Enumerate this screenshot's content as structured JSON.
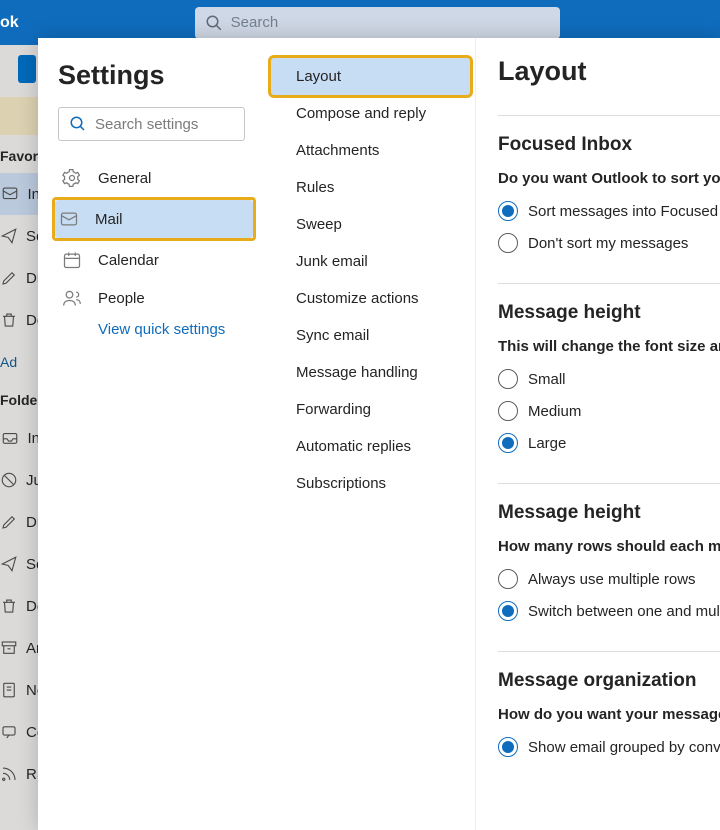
{
  "topbar": {
    "app_name": "ok",
    "search_placeholder": "Search"
  },
  "bg": {
    "section_favorites": "Favori",
    "section_folders": "Folder",
    "items_fav": [
      {
        "label": "In"
      },
      {
        "label": "Se"
      },
      {
        "label": "Dr"
      },
      {
        "label": "De"
      }
    ],
    "add": "Ad",
    "items_fold": [
      {
        "label": "In"
      },
      {
        "label": "Ju"
      },
      {
        "label": "Dr"
      },
      {
        "label": "Se"
      },
      {
        "label": "De"
      },
      {
        "label": "Ar"
      },
      {
        "label": "No"
      },
      {
        "label": "Co"
      },
      {
        "label": "RS"
      }
    ]
  },
  "settings": {
    "title": "Settings",
    "search_placeholder": "Search settings",
    "categories": [
      {
        "label": "General",
        "icon": "gear"
      },
      {
        "label": "Mail",
        "icon": "mail"
      },
      {
        "label": "Calendar",
        "icon": "calendar"
      },
      {
        "label": "People",
        "icon": "people"
      }
    ],
    "view_quick": "View quick settings",
    "mail_subs": [
      "Layout",
      "Compose and reply",
      "Attachments",
      "Rules",
      "Sweep",
      "Junk email",
      "Customize actions",
      "Sync email",
      "Message handling",
      "Forwarding",
      "Automatic replies",
      "Subscriptions"
    ]
  },
  "panel": {
    "title": "Layout",
    "s1": {
      "heading": "Focused Inbox",
      "desc": "Do you want Outlook to sort your",
      "o1": "Sort messages into Focused an",
      "o2": "Don't sort my messages"
    },
    "s2": {
      "heading": "Message height",
      "desc": "This will change the font size and",
      "o1": "Small",
      "o2": "Medium",
      "o3": "Large"
    },
    "s3": {
      "heading": "Message height",
      "desc": "How many rows should each mess",
      "o1": "Always use multiple rows",
      "o2": "Switch between one and multi"
    },
    "s4": {
      "heading": "Message organization",
      "desc": "How do you want your messages",
      "o1": "Show email grouped by conve"
    }
  }
}
